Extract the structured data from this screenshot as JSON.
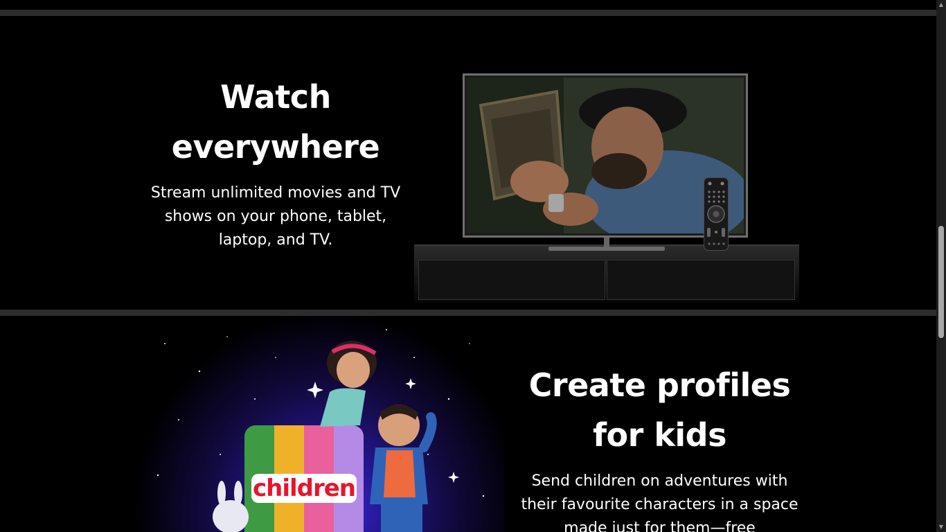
{
  "watch_section": {
    "title": "Watch everywhere",
    "description": "Stream unlimited movies and TV shows on your phone, tablet, laptop, and TV."
  },
  "kids_section": {
    "title": "Create profiles for kids",
    "description": "Send children on adventures with their favourite characters in a space made just for them—free",
    "art_label": "children"
  },
  "colors": {
    "background": "#000000",
    "divider": "#2d2d2d",
    "text": "#ffffff",
    "kids_label_red": "#e8142c",
    "tile_stripes": [
      "#3f9a44",
      "#f0b12a",
      "#e9609c",
      "#b58ae6"
    ]
  },
  "icons": {
    "scroll_up": "▲",
    "scroll_down": "▼"
  }
}
